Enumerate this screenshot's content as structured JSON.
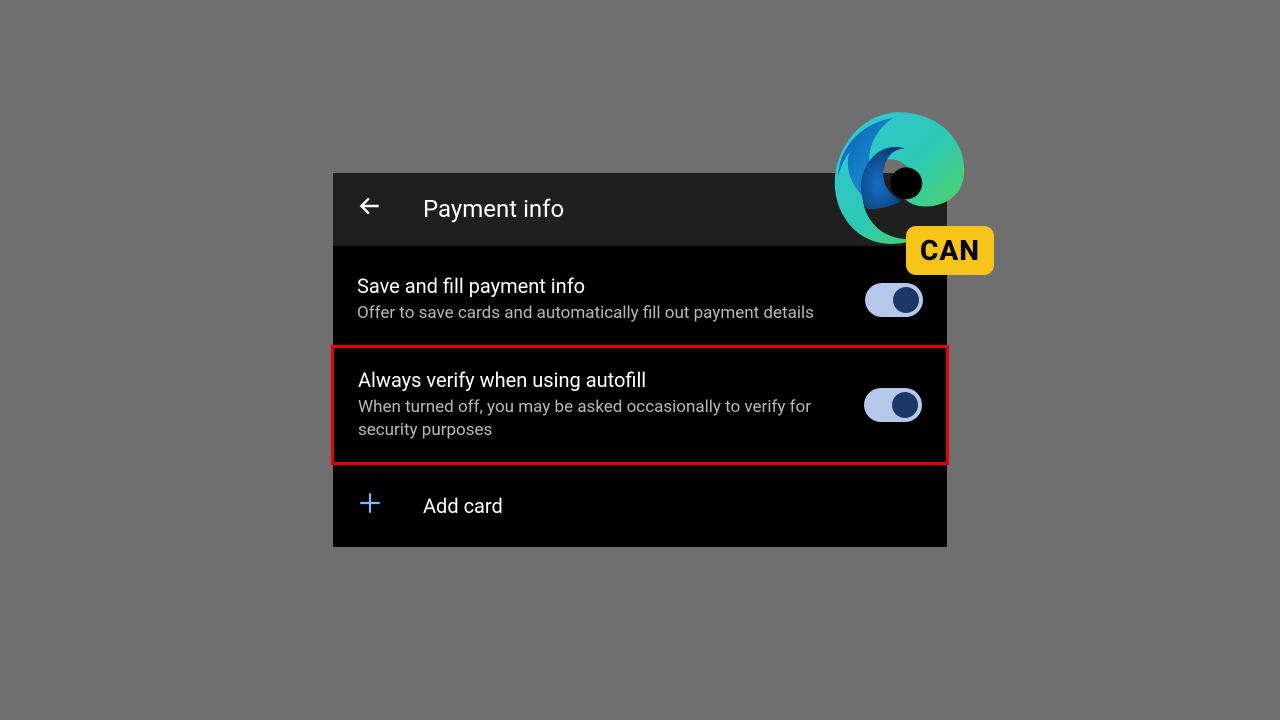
{
  "header": {
    "title": "Payment info"
  },
  "settings": {
    "saveFill": {
      "title": "Save and fill payment info",
      "description": "Offer to save cards and automatically fill out payment details"
    },
    "alwaysVerify": {
      "title": "Always verify when using autofill",
      "description": "When turned off, you may be asked occasionally to verify for security purposes"
    }
  },
  "addCard": {
    "label": "Add card"
  },
  "badge": {
    "label": "CAN"
  }
}
